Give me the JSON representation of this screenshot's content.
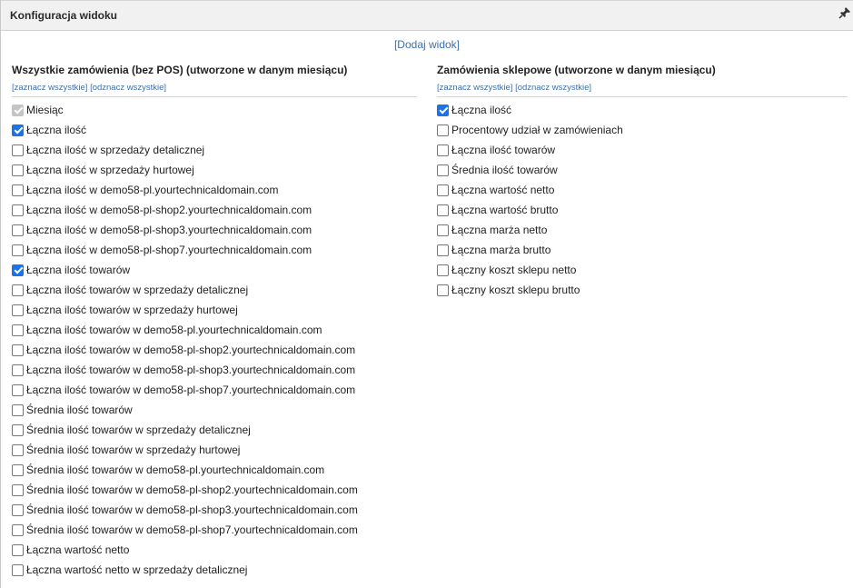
{
  "dialog": {
    "title": "Konfiguracja widoku",
    "add_view_link": "[Dodaj widok]"
  },
  "left_column": {
    "heading": "Wszystkie zamówienia (bez POS) (utworzone w danym miesiącu)",
    "select_all": "[zaznacz wszystkie]",
    "deselect_all": "[odznacz wszystkie]",
    "items": [
      {
        "label": "Miesiąc",
        "checked": true,
        "disabled": true
      },
      {
        "label": "Łączna ilość",
        "checked": true
      },
      {
        "label": "Łączna ilość w sprzedaży detalicznej",
        "checked": false
      },
      {
        "label": "Łączna ilość w sprzedaży hurtowej",
        "checked": false
      },
      {
        "label": "Łączna ilość w demo58-pl.yourtechnicaldomain.com",
        "checked": false
      },
      {
        "label": "Łączna ilość w demo58-pl-shop2.yourtechnicaldomain.com",
        "checked": false
      },
      {
        "label": "Łączna ilość w demo58-pl-shop3.yourtechnicaldomain.com",
        "checked": false
      },
      {
        "label": "Łączna ilość w demo58-pl-shop7.yourtechnicaldomain.com",
        "checked": false
      },
      {
        "label": "Łączna ilość towarów",
        "checked": true
      },
      {
        "label": "Łączna ilość towarów w sprzedaży detalicznej",
        "checked": false
      },
      {
        "label": "Łączna ilość towarów w sprzedaży hurtowej",
        "checked": false
      },
      {
        "label": "Łączna ilość towarów w demo58-pl.yourtechnicaldomain.com",
        "checked": false
      },
      {
        "label": "Łączna ilość towarów w demo58-pl-shop2.yourtechnicaldomain.com",
        "checked": false
      },
      {
        "label": "Łączna ilość towarów w demo58-pl-shop3.yourtechnicaldomain.com",
        "checked": false
      },
      {
        "label": "Łączna ilość towarów w demo58-pl-shop7.yourtechnicaldomain.com",
        "checked": false
      },
      {
        "label": "Średnia ilość towarów",
        "checked": false
      },
      {
        "label": "Średnia ilość towarów w sprzedaży detalicznej",
        "checked": false
      },
      {
        "label": "Średnia ilość towarów w sprzedaży hurtowej",
        "checked": false
      },
      {
        "label": "Średnia ilość towarów w demo58-pl.yourtechnicaldomain.com",
        "checked": false
      },
      {
        "label": "Średnia ilość towarów w demo58-pl-shop2.yourtechnicaldomain.com",
        "checked": false
      },
      {
        "label": "Średnia ilość towarów w demo58-pl-shop3.yourtechnicaldomain.com",
        "checked": false
      },
      {
        "label": "Średnia ilość towarów w demo58-pl-shop7.yourtechnicaldomain.com",
        "checked": false
      },
      {
        "label": "Łączna wartość netto",
        "checked": false
      },
      {
        "label": "Łączna wartość netto w sprzedaży detalicznej",
        "checked": false
      }
    ]
  },
  "right_column": {
    "heading": "Zamówienia sklepowe (utworzone w danym miesiącu)",
    "select_all": "[zaznacz wszystkie]",
    "deselect_all": "[odznacz wszystkie]",
    "items": [
      {
        "label": "Łączna ilość",
        "checked": true
      },
      {
        "label": "Procentowy udział w zamówieniach",
        "checked": false
      },
      {
        "label": "Łączna ilość towarów",
        "checked": false
      },
      {
        "label": "Średnia ilość towarów",
        "checked": false
      },
      {
        "label": "Łączna wartość netto",
        "checked": false
      },
      {
        "label": "Łączna wartość brutto",
        "checked": false
      },
      {
        "label": "Łączna marża netto",
        "checked": false
      },
      {
        "label": "Łączna marża brutto",
        "checked": false
      },
      {
        "label": "Łączny koszt sklepu netto",
        "checked": false
      },
      {
        "label": "Łączny koszt sklepu brutto",
        "checked": false
      }
    ]
  },
  "colors": {
    "link": "#3b6fb0",
    "checkbox_checked": "#1a73e8",
    "titlebar_bg": "#f1f1f1"
  },
  "icons": {
    "pin": "pin-icon"
  }
}
